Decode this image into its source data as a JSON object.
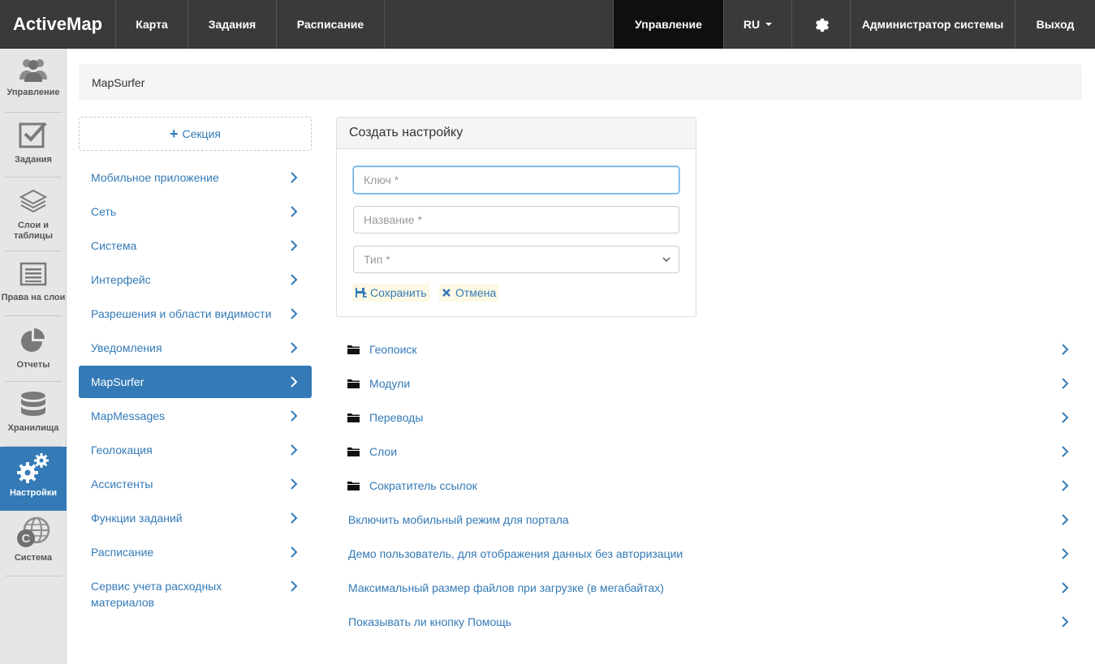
{
  "topbar": {
    "brand": "ActiveMap",
    "nav": [
      "Карта",
      "Задания",
      "Расписание"
    ],
    "manage": "Управление",
    "lang": "RU",
    "user": "Администратор системы",
    "logout": "Выход"
  },
  "sidebar": {
    "items": [
      {
        "label": "Управление",
        "icon": "users-icon"
      },
      {
        "label": "Задания",
        "icon": "checkbox-icon"
      },
      {
        "label": "Слои и таблицы",
        "icon": "layers-icon"
      },
      {
        "label": "Права на слои",
        "icon": "list-icon"
      },
      {
        "label": "Отчеты",
        "icon": "pie-chart-icon"
      },
      {
        "label": "Хранилища",
        "icon": "database-icon"
      },
      {
        "label": "Настройки",
        "icon": "gears-icon"
      },
      {
        "label": "Система",
        "icon": "globe-icon"
      }
    ],
    "active_index": 6
  },
  "breadcrumb": "MapSurfer",
  "sections": {
    "add_label": "Секция",
    "items": [
      "Мобильное приложение",
      "Сеть",
      "Система",
      "Интерфейс",
      "Разрешения и области видимости",
      "Уведомления",
      "MapSurfer",
      "MapMessages",
      "Геолокация",
      "Ассистенты",
      "Функции заданий",
      "Расписание",
      "Сервис учета расходных материалов"
    ],
    "active_index": 6
  },
  "create_panel": {
    "title": "Создать настройку",
    "key_placeholder": "Ключ *",
    "name_placeholder": "Название *",
    "type_placeholder": "Тип *",
    "save": "Сохранить",
    "cancel": "Отмена"
  },
  "folders": [
    "Геопоиск",
    "Модули",
    "Переводы",
    "Слои",
    "Сократитель ссылок"
  ],
  "settings": [
    "Включить мобильный режим для портала",
    "Демо пользователь, для отображения данных без авторизации",
    "Максимальный размер файлов при загрузке (в мегабайтах)",
    "Показывать ли кнопку Помощь"
  ],
  "colors": {
    "accent": "#337ab7",
    "navbar": "#3a3a3a",
    "nav_active": "#0f0f0f",
    "sidebar": "#e6e6e6",
    "button_bg": "#fcf8e3"
  }
}
